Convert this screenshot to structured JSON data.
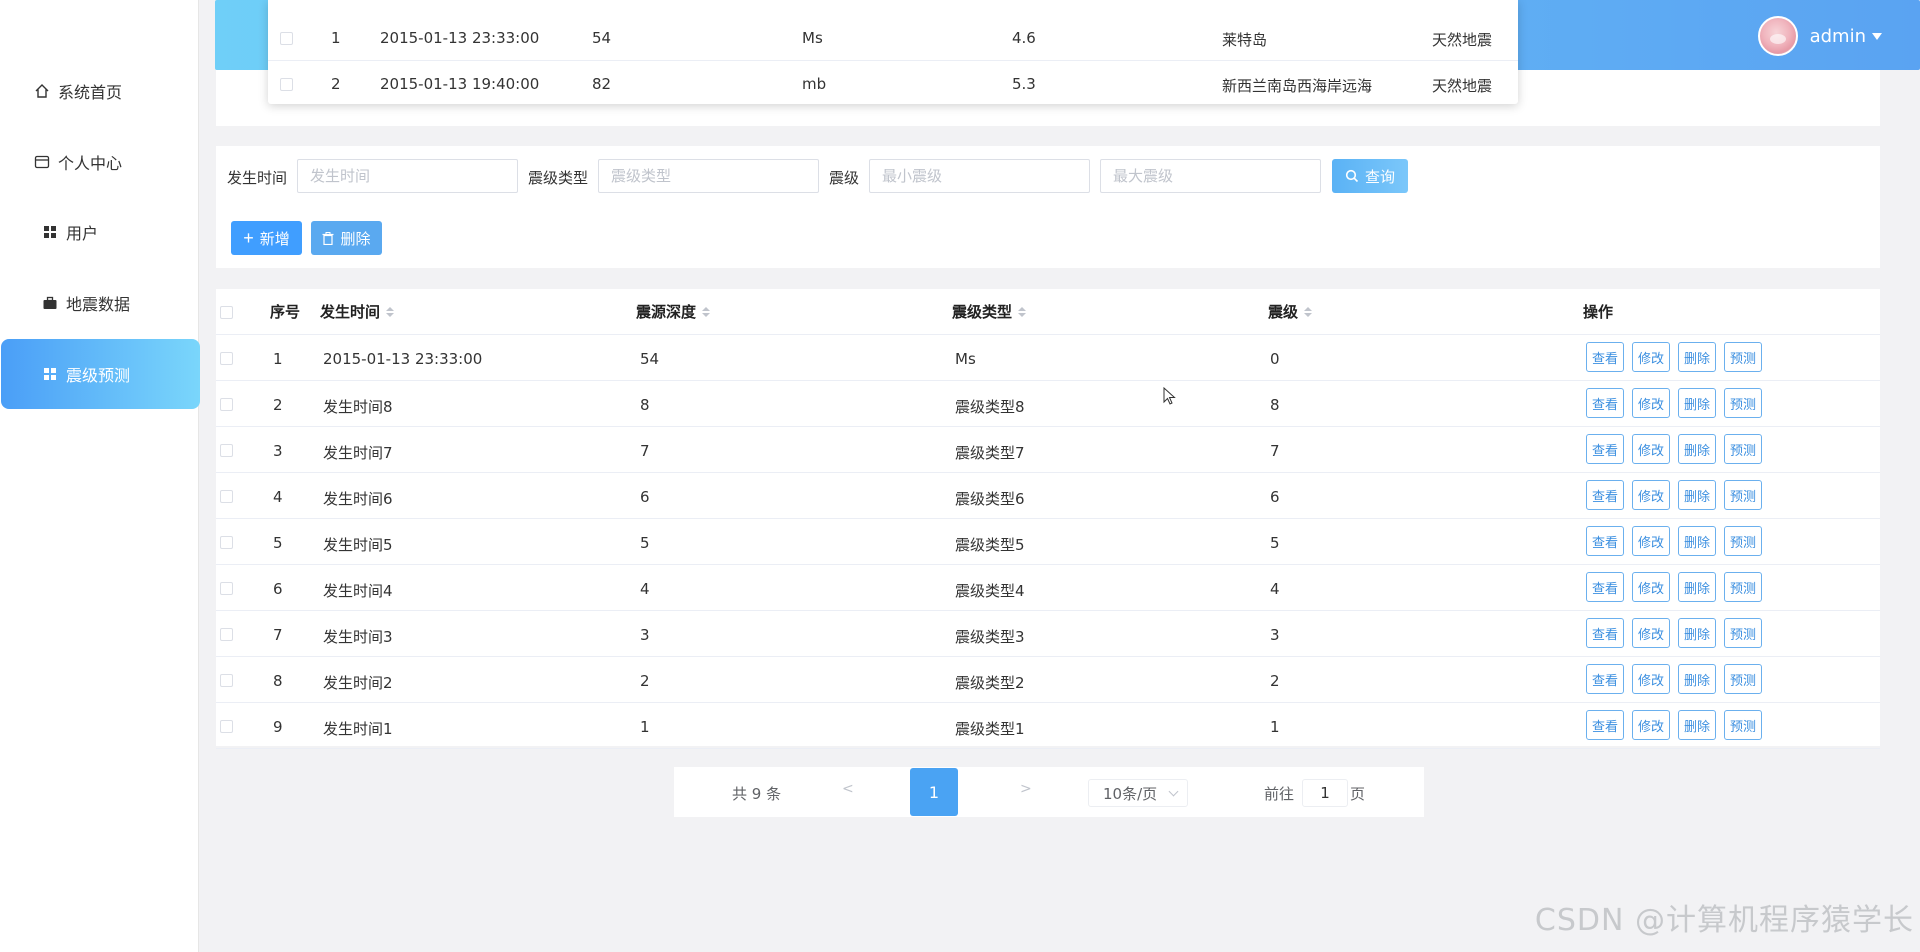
{
  "sidebar": {
    "items": [
      {
        "label": "系统首页",
        "icon": "home-icon"
      },
      {
        "label": "个人中心",
        "icon": "card-icon"
      },
      {
        "label": "用户",
        "icon": "grid-icon"
      },
      {
        "label": "地震数据",
        "icon": "briefcase-icon"
      },
      {
        "label": "震级预测",
        "icon": "grid-icon",
        "active": true
      }
    ]
  },
  "header": {
    "username": "admin"
  },
  "popup": {
    "rows": [
      {
        "no": "1",
        "time": "2015-01-13 23:33:00",
        "depth": "54",
        "type": "Ms",
        "mag": "4.6",
        "place": "莱特岛",
        "kind": "天然地震"
      },
      {
        "no": "2",
        "time": "2015-01-13 19:40:00",
        "depth": "82",
        "type": "mb",
        "mag": "5.3",
        "place": "新西兰南岛西海岸远海",
        "kind": "天然地震"
      }
    ]
  },
  "search": {
    "time_label": "发生时间",
    "time_placeholder": "发生时间",
    "type_label": "震级类型",
    "type_placeholder": "震级类型",
    "mag_label": "震级",
    "min_placeholder": "最小震级",
    "max_placeholder": "最大震级",
    "query_button": "查询",
    "add_button": "新增",
    "delete_button": "删除"
  },
  "table": {
    "headers": {
      "no": "序号",
      "time": "发生时间",
      "depth": "震源深度",
      "type": "震级类型",
      "mag": "震级",
      "ops": "操作"
    },
    "ops": {
      "view": "查看",
      "edit": "修改",
      "delete": "删除",
      "predict": "预测"
    },
    "rows": [
      {
        "no": "1",
        "time": "2015-01-13 23:33:00",
        "depth": "54",
        "type": "Ms",
        "mag": "0"
      },
      {
        "no": "2",
        "time": "发生时间8",
        "depth": "8",
        "type": "震级类型8",
        "mag": "8"
      },
      {
        "no": "3",
        "time": "发生时间7",
        "depth": "7",
        "type": "震级类型7",
        "mag": "7"
      },
      {
        "no": "4",
        "time": "发生时间6",
        "depth": "6",
        "type": "震级类型6",
        "mag": "6"
      },
      {
        "no": "5",
        "time": "发生时间5",
        "depth": "5",
        "type": "震级类型5",
        "mag": "5"
      },
      {
        "no": "6",
        "time": "发生时间4",
        "depth": "4",
        "type": "震级类型4",
        "mag": "4"
      },
      {
        "no": "7",
        "time": "发生时间3",
        "depth": "3",
        "type": "震级类型3",
        "mag": "3"
      },
      {
        "no": "8",
        "time": "发生时间2",
        "depth": "2",
        "type": "震级类型2",
        "mag": "2"
      },
      {
        "no": "9",
        "time": "发生时间1",
        "depth": "1",
        "type": "震级类型1",
        "mag": "1"
      }
    ]
  },
  "pagination": {
    "total": "共 9 条",
    "prev": "<",
    "current": "1",
    "next": ">",
    "page_size": "10条/页",
    "goto_label": "前往",
    "goto_value": "1",
    "page_suffix": "页"
  },
  "watermark": "CSDN @计算机程序猿学长"
}
